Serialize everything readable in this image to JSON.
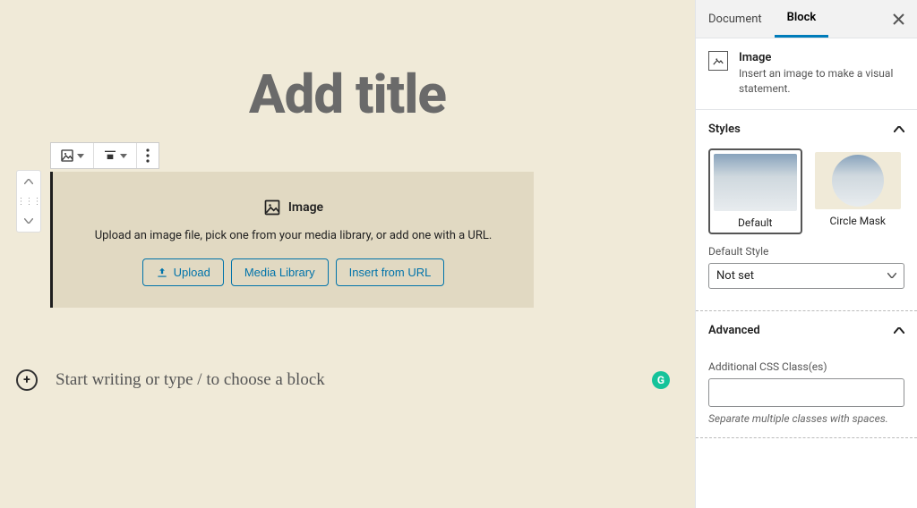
{
  "editor": {
    "title_placeholder": "Add title",
    "appender_placeholder": "Start writing or type / to choose a block"
  },
  "block": {
    "type_label": "Image",
    "placeholder_desc": "Upload an image file, pick one from your media library, or add one with a URL.",
    "buttons": {
      "upload": "Upload",
      "media_library": "Media Library",
      "insert_url": "Insert from URL"
    }
  },
  "sidebar": {
    "tabs": {
      "document": "Document",
      "block": "Block"
    },
    "card": {
      "title": "Image",
      "desc": "Insert an image to make a visual statement."
    },
    "styles": {
      "heading": "Styles",
      "default": "Default",
      "circle_mask": "Circle Mask",
      "default_style_label": "Default Style",
      "default_style_value": "Not set"
    },
    "advanced": {
      "heading": "Advanced",
      "css_label": "Additional CSS Class(es)",
      "css_hint": "Separate multiple classes with spaces."
    }
  }
}
